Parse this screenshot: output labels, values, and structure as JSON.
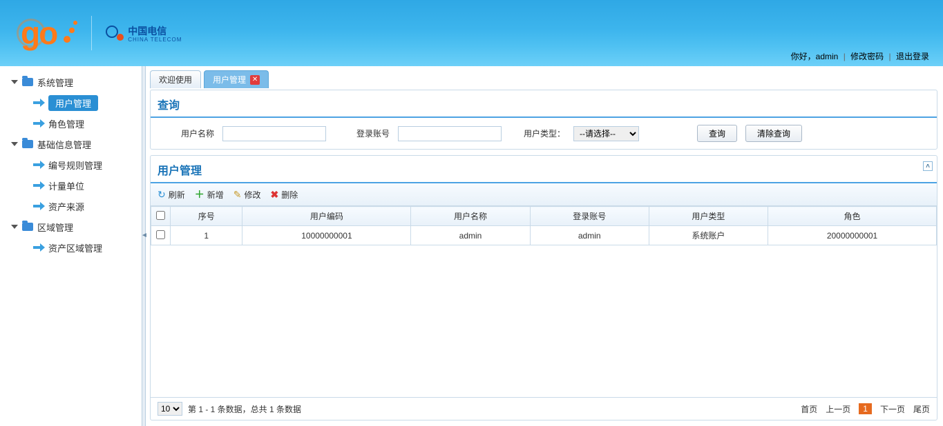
{
  "header": {
    "telecom_name": "中国电信",
    "telecom_sub": "CHINA TELECOM",
    "greeting": "你好，admin",
    "change_pwd": "修改密码",
    "logout": "退出登录"
  },
  "sidebar": {
    "groups": [
      {
        "label": "系统管理",
        "items": [
          {
            "label": "用户管理",
            "selected": true
          },
          {
            "label": "角色管理"
          }
        ]
      },
      {
        "label": "基础信息管理",
        "items": [
          {
            "label": "编号规则管理"
          },
          {
            "label": "计量单位"
          },
          {
            "label": "资产来源"
          }
        ]
      },
      {
        "label": "区域管理",
        "items": [
          {
            "label": "资产区域管理"
          }
        ]
      }
    ]
  },
  "tabs": {
    "welcome": "欢迎使用",
    "active": "用户管理"
  },
  "search": {
    "title": "查询",
    "username_label": "用户名称",
    "login_label": "登录账号",
    "type_label": "用户类型：",
    "type_placeholder": "--请选择--",
    "query_btn": "查询",
    "clear_btn": "清除查询"
  },
  "grid": {
    "title": "用户管理",
    "toolbar": {
      "refresh": "刷新",
      "add": "新增",
      "edit": "修改",
      "del": "删除"
    },
    "cols": [
      "序号",
      "用户编码",
      "用户名称",
      "登录账号",
      "用户类型",
      "角色"
    ],
    "rows": [
      {
        "seq": "1",
        "code": "10000000001",
        "name": "admin",
        "login": "admin",
        "type": "系统账户",
        "role": "20000000001"
      }
    ]
  },
  "pager": {
    "size": "10",
    "info": "第 1 - 1 条数据，总共 1 条数据",
    "first": "首页",
    "prev": "上一页",
    "page": "1",
    "next": "下一页",
    "last": "尾页"
  }
}
